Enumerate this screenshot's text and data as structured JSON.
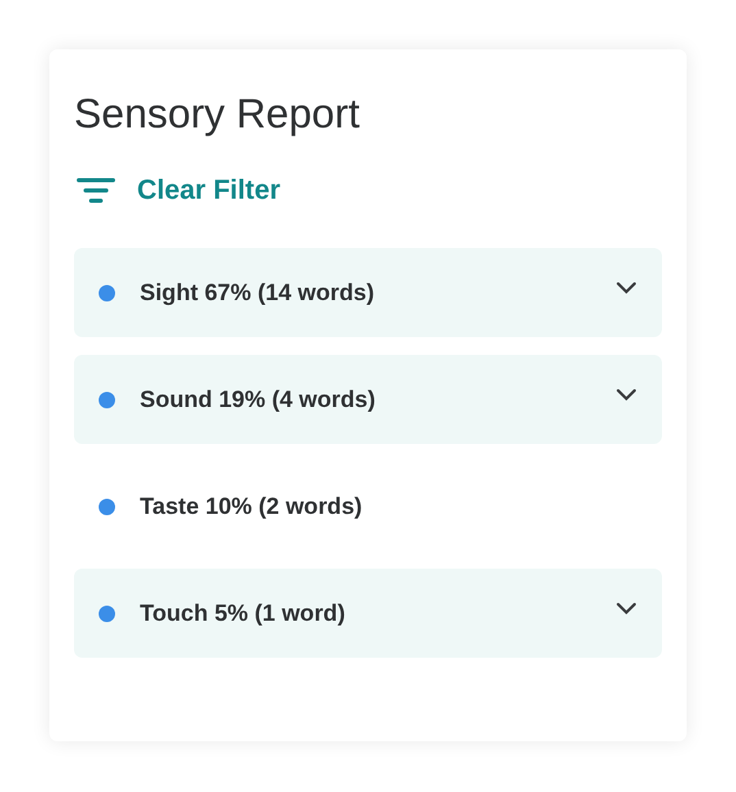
{
  "title": "Sensory Report",
  "filter_link": {
    "label": "Clear Filter"
  },
  "senses": [
    {
      "label": "Sight 67% (14 words)",
      "expandable": true
    },
    {
      "label": "Sound 19% (4 words)",
      "expandable": true
    },
    {
      "label": "Taste 10% (2 words)",
      "expandable": false
    },
    {
      "label": "Touch 5% (1 word)",
      "expandable": true
    }
  ]
}
